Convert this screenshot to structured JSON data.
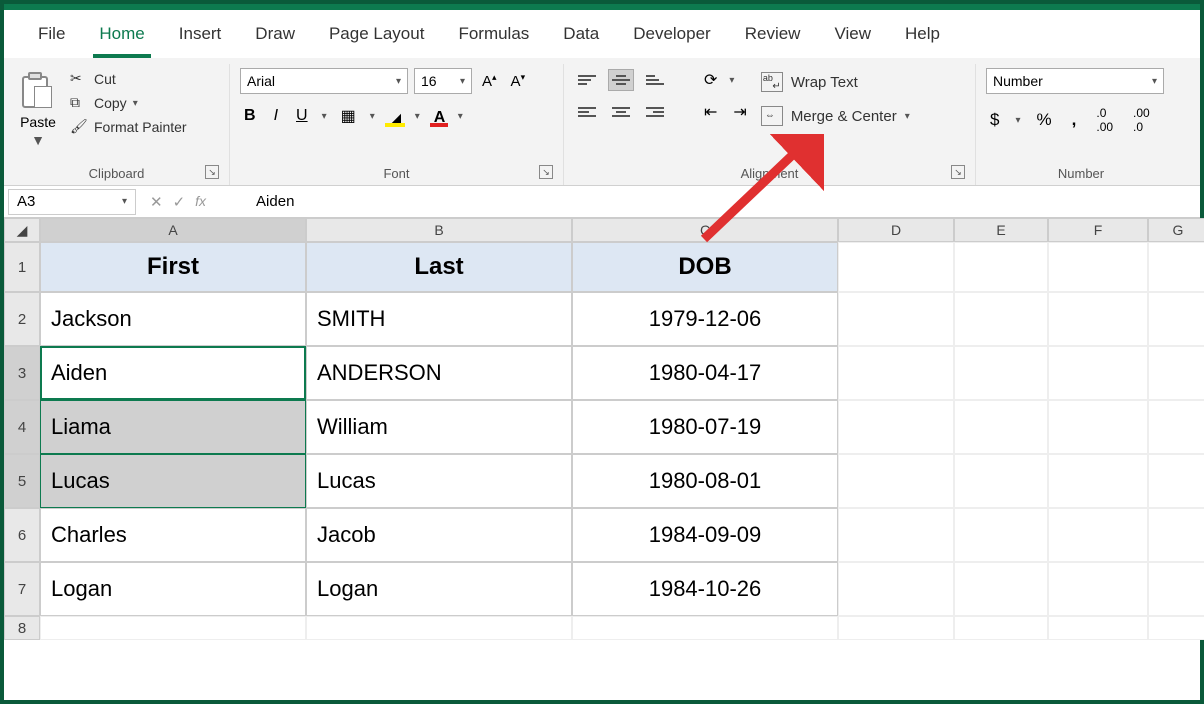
{
  "ribbon_tabs": [
    "File",
    "Home",
    "Insert",
    "Draw",
    "Page Layout",
    "Formulas",
    "Data",
    "Developer",
    "Review",
    "View",
    "Help"
  ],
  "active_tab": "Home",
  "clipboard": {
    "paste": "Paste",
    "cut": "Cut",
    "copy": "Copy",
    "format_painter": "Format Painter",
    "group_label": "Clipboard"
  },
  "font": {
    "name": "Arial",
    "size": "16",
    "group_label": "Font"
  },
  "alignment": {
    "wrap": "Wrap Text",
    "merge": "Merge & Center",
    "group_label": "Alignment"
  },
  "number": {
    "format": "Number",
    "group_label": "Number"
  },
  "namebox": "A3",
  "formula_value": "Aiden",
  "columns": [
    "A",
    "B",
    "C",
    "D",
    "E",
    "F",
    "G"
  ],
  "headers": {
    "first": "First",
    "last": "Last",
    "dob": "DOB"
  },
  "rows": [
    {
      "first": "Jackson",
      "last": "SMITH",
      "dob": "1979-12-06"
    },
    {
      "first": "Aiden",
      "last": "ANDERSON",
      "dob": "1980-04-17"
    },
    {
      "first": "Liama",
      "last": "William",
      "dob": "1980-07-19"
    },
    {
      "first": "Lucas",
      "last": "Lucas",
      "dob": "1980-08-01"
    },
    {
      "first": "Charles",
      "last": "Jacob",
      "dob": "1984-09-09"
    },
    {
      "first": "Logan",
      "last": "Logan",
      "dob": "1984-10-26"
    }
  ]
}
